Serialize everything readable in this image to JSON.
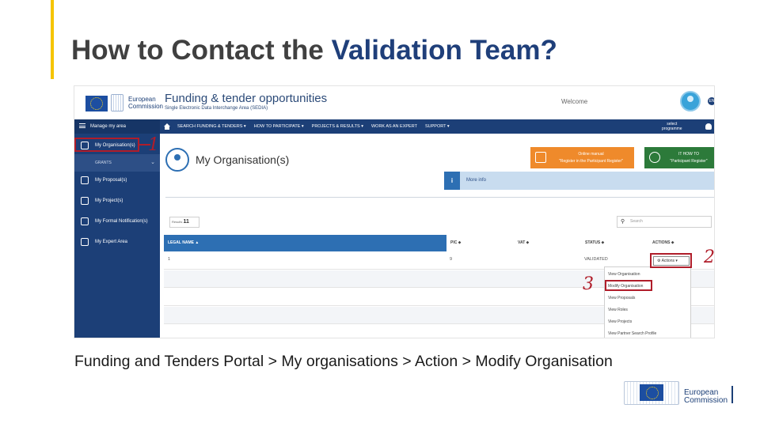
{
  "slide": {
    "title_part1": "How to Contact the ",
    "title_highlight": "Validation Team?",
    "caption": "Funding and Tenders Portal > My organisations > Action > Modify Organisation",
    "footer_logo_line1": "European",
    "footer_logo_line2": "Commission"
  },
  "portal": {
    "logo_line1": "European",
    "logo_line2": "Commission",
    "title": "Funding & tender opportunities",
    "subtitle": "Single Electronic Data Interchange Area (SEDIA)",
    "welcome": "Welcome",
    "lang_badge": "EN"
  },
  "nav": {
    "manage": "Manage my area",
    "items": [
      "SEARCH FUNDING & TENDERS ▾",
      "HOW TO PARTICIPATE ▾",
      "PROJECTS & RESULTS ▾",
      "WORK AS AN EXPERT",
      "SUPPORT ▾"
    ],
    "select_programme_l1": "select",
    "select_programme_l2": "programme"
  },
  "sidebar": {
    "items": [
      {
        "label": "My Organisation(s)"
      },
      {
        "label": "GRANTS"
      },
      {
        "label": "My Proposal(s)"
      },
      {
        "label": "My Project(s)"
      },
      {
        "label": "My Formal Notification(s)"
      },
      {
        "label": "My Expert Area"
      }
    ]
  },
  "main": {
    "heading": "My Organisation(s)",
    "manual_l1": "Online manual",
    "manual_l2": "\"Register in the Participant Register\"",
    "howto_l1": "IT HOW TO",
    "howto_l2": "\"Participant Register\"",
    "more_info": "More info",
    "info_glyph": "i",
    "results_label": "Results",
    "results_count": "11",
    "search_placeholder": "Search",
    "columns": [
      "LEGAL NAME ▲",
      "PIC ⬥",
      "VAT ⬥",
      "STATUS ⬥",
      "ACTIONS ⬥"
    ],
    "row1": {
      "legal_name": "1",
      "pic": "9",
      "status": "VALIDATED"
    },
    "actions_button": "⚙ Actions ▾",
    "dropdown": [
      "View Organisation",
      "Modify Organisation",
      "View Proposals",
      "View Roles",
      "View Projects",
      "View Partner Search Profile"
    ]
  },
  "annotations": [
    "1",
    "2",
    "3"
  ],
  "colors": {
    "accent": "#f5c400",
    "title_highlight": "#1f3f7a",
    "nav": "#1c3f77",
    "annotation": "#b01d2a"
  }
}
